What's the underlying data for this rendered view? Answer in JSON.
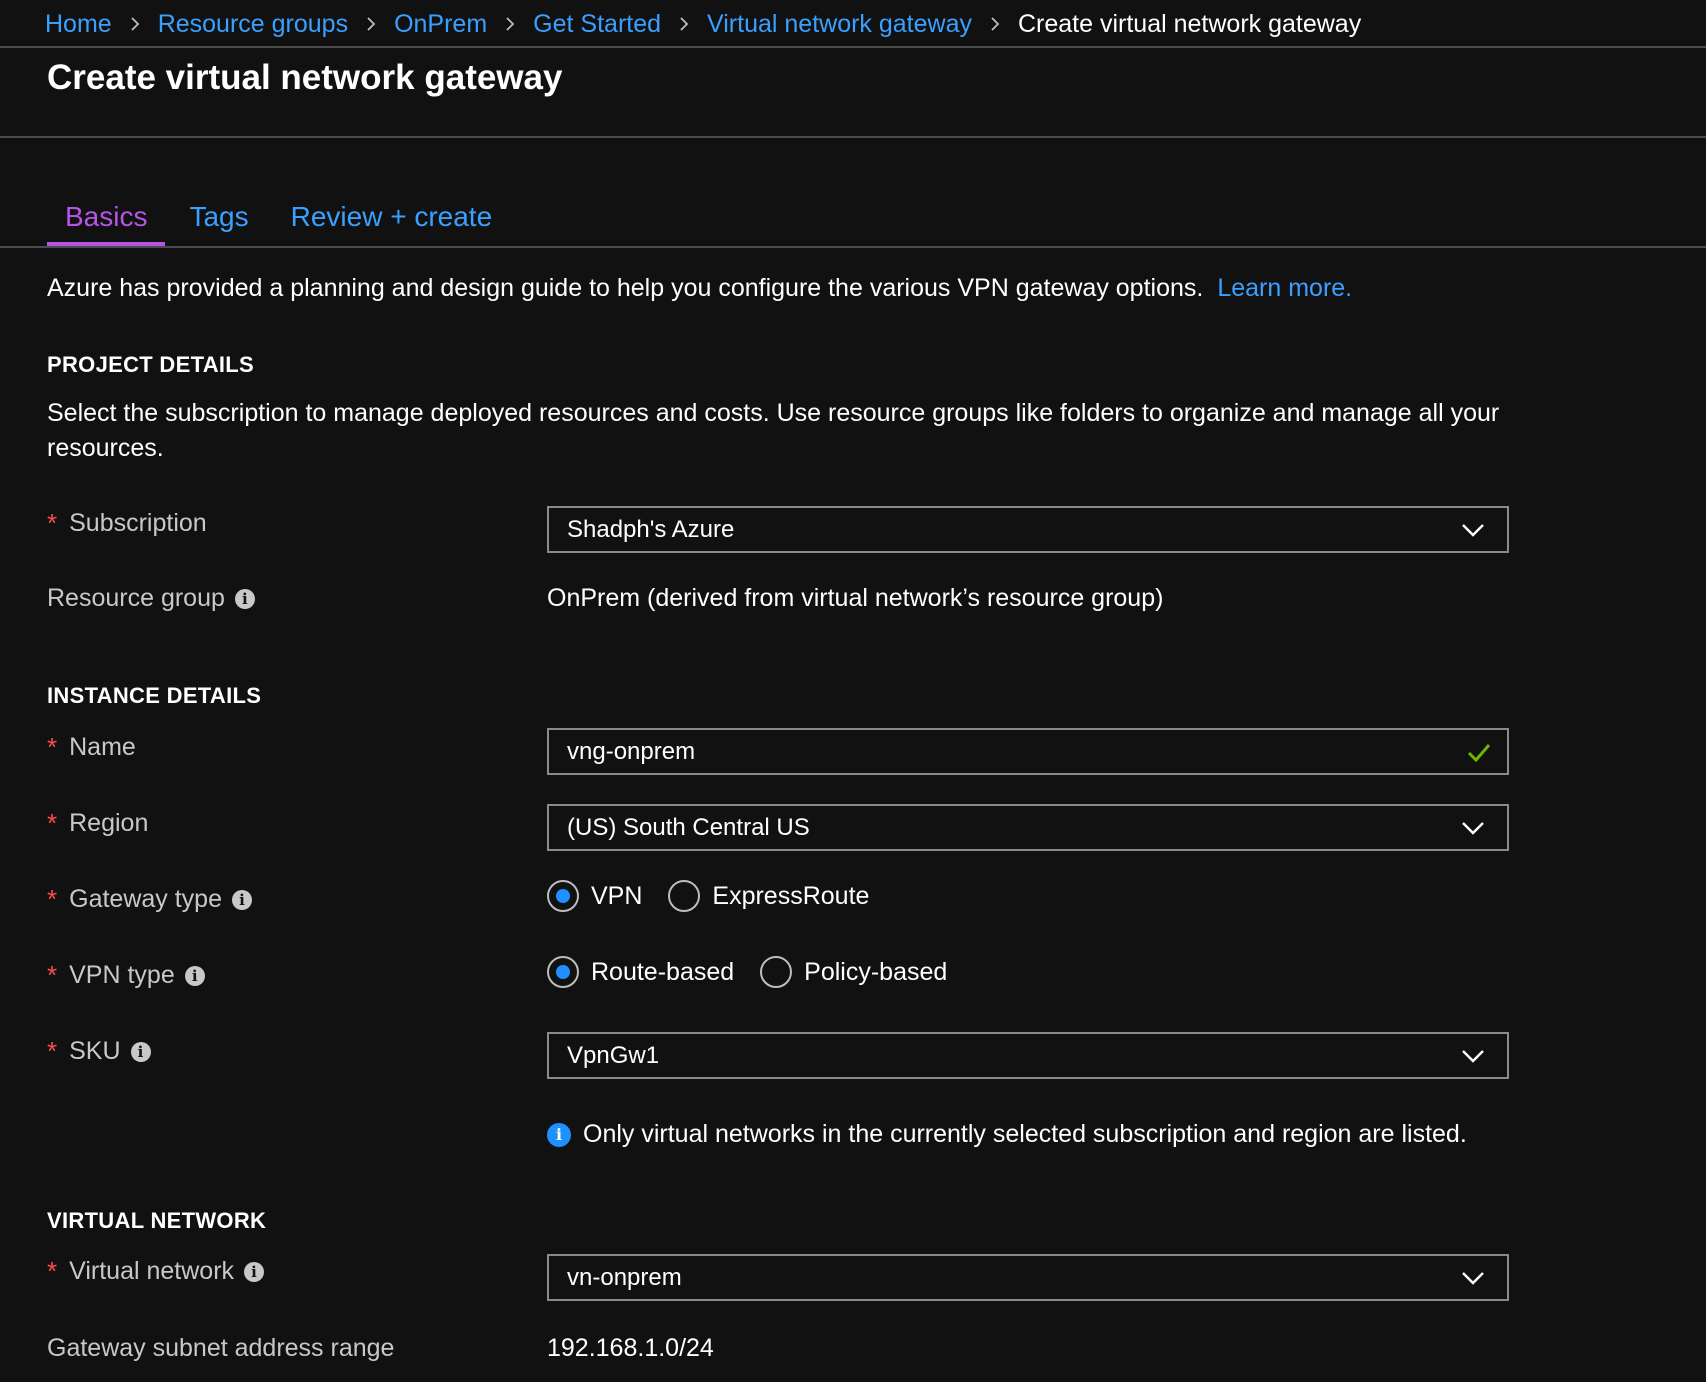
{
  "breadcrumb": {
    "items": [
      "Home",
      "Resource groups",
      "OnPrem",
      "Get Started",
      "Virtual network gateway"
    ],
    "current": "Create virtual network gateway"
  },
  "page_title": "Create virtual network gateway",
  "tabs": [
    {
      "label": "Basics",
      "active": true
    },
    {
      "label": "Tags",
      "active": false
    },
    {
      "label": "Review + create",
      "active": false
    }
  ],
  "intro": {
    "text": "Azure has provided a planning and design guide to help you configure the various VPN gateway options.",
    "link": "Learn more."
  },
  "project_details": {
    "heading": "PROJECT DETAILS",
    "description": "Select the subscription to manage deployed resources and costs. Use resource groups like folders to organize and manage all your resources.",
    "subscription": {
      "label": "Subscription",
      "value": "Shadph's Azure"
    },
    "resource_group": {
      "label": "Resource group",
      "value": "OnPrem (derived from virtual network’s resource group)"
    }
  },
  "instance_details": {
    "heading": "INSTANCE DETAILS",
    "name": {
      "label": "Name",
      "value": "vng-onprem"
    },
    "region": {
      "label": "Region",
      "value": "(US) South Central US"
    },
    "gateway_type": {
      "label": "Gateway type",
      "options": [
        "VPN",
        "ExpressRoute"
      ],
      "selected": "VPN"
    },
    "vpn_type": {
      "label": "VPN type",
      "options": [
        "Route-based",
        "Policy-based"
      ],
      "selected": "Route-based"
    },
    "sku": {
      "label": "SKU",
      "value": "VpnGw1"
    },
    "note": "Only virtual networks in the currently selected subscription and region are listed."
  },
  "virtual_network": {
    "heading": "VIRTUAL NETWORK",
    "vnet": {
      "label": "Virtual network",
      "value": "vn-onprem"
    },
    "subnet_range": {
      "label": "Gateway subnet address range",
      "value": "192.168.1.0/24"
    }
  },
  "colors": {
    "background": "#111111",
    "link": "#3aa0ff",
    "active_tab": "#b455e6",
    "required": "#ff4a4a",
    "radio_selected": "#1e90ff",
    "valid_check": "#6bb700"
  },
  "icons": {
    "breadcrumb_separator": "chevron-right-icon",
    "dropdown": "chevron-down-icon",
    "info": "info-icon",
    "valid": "checkmark-icon"
  }
}
